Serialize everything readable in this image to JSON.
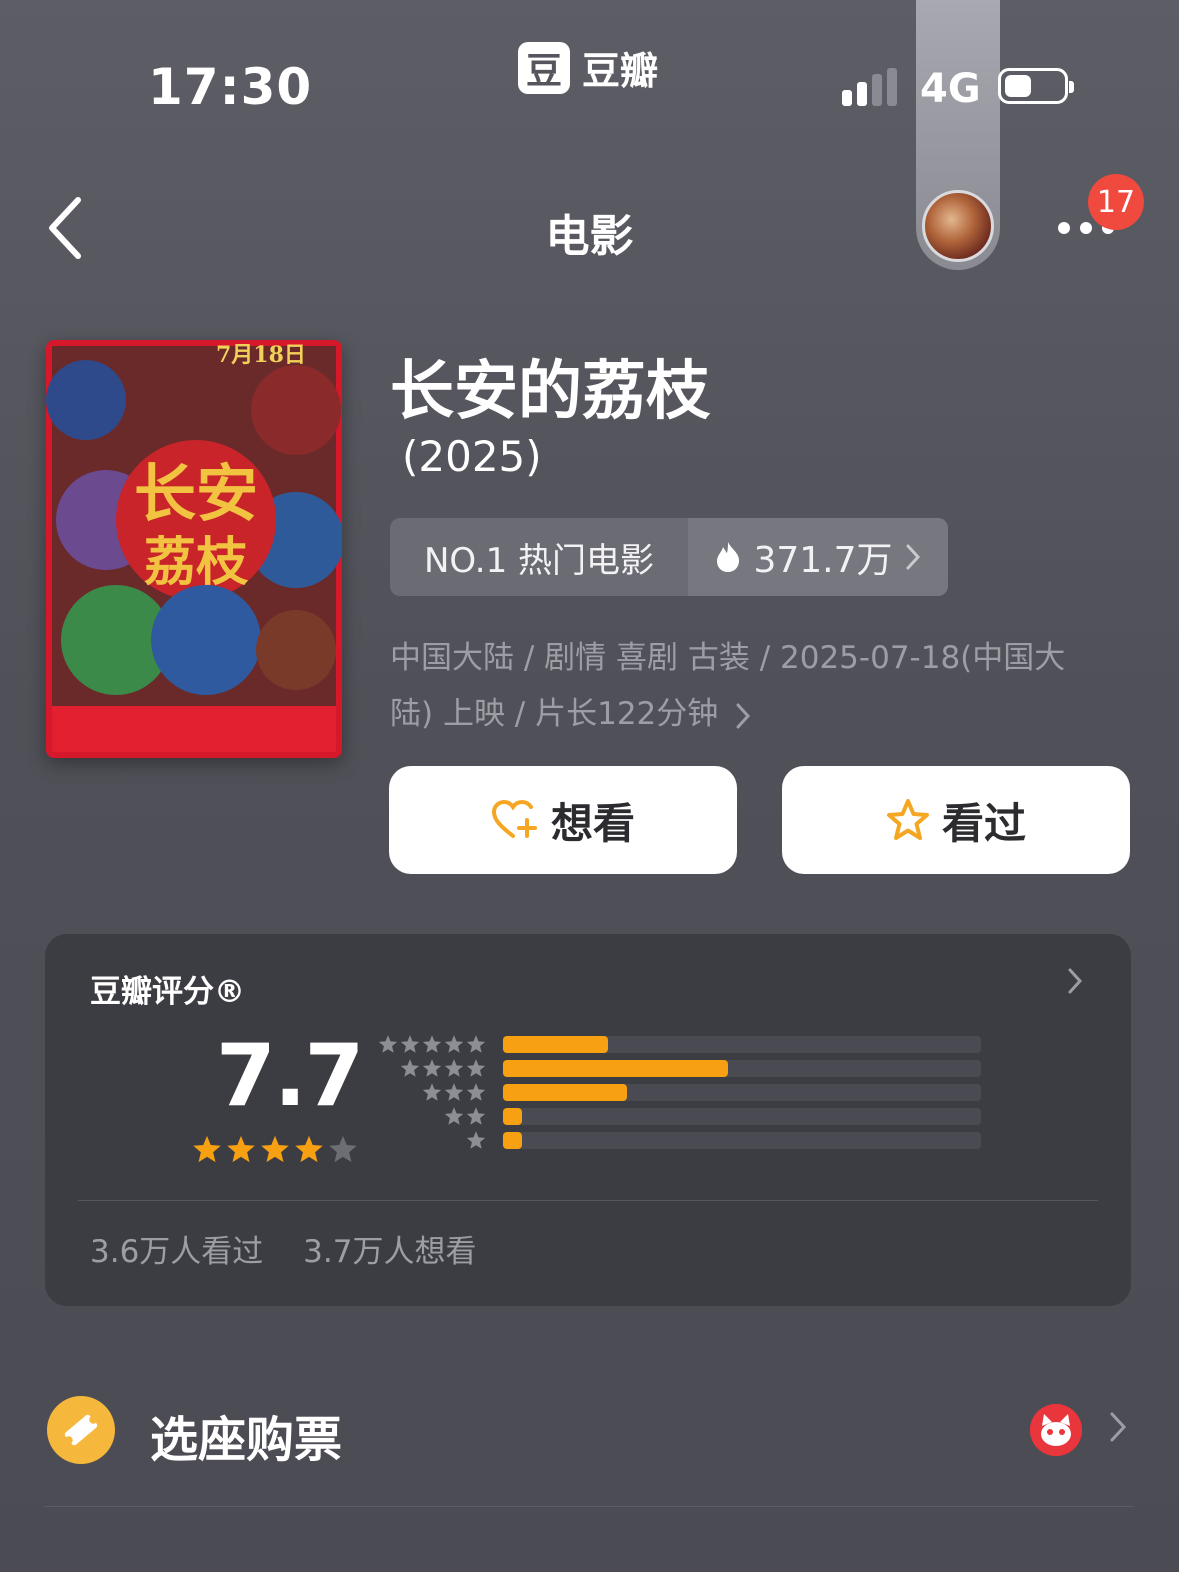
{
  "status_bar": {
    "time": "17:30",
    "brand_logo_char": "豆",
    "brand_name": "豆瓣",
    "network": "4G",
    "battery_level": 0.3
  },
  "nav": {
    "title": "电影",
    "notification_count": "17"
  },
  "movie": {
    "title": "长安的荔枝",
    "year": "(2025)",
    "rank_label": "NO.1 热门电影",
    "heat_value": "371.7万",
    "meta_line1": "中国大陆 / 剧情 喜剧 古装 / 2025-07-18(中国大",
    "meta_line2": "陆) 上映 / 片长122分钟"
  },
  "actions": {
    "want_label": "想看",
    "seen_label": "看过"
  },
  "rating": {
    "title": "豆瓣评分®",
    "score": "7.7",
    "score_stars": 4,
    "distribution": [
      {
        "stars": 5,
        "fraction": 0.22
      },
      {
        "stars": 4,
        "fraction": 0.47
      },
      {
        "stars": 3,
        "fraction": 0.26
      },
      {
        "stars": 2,
        "fraction": 0.04
      },
      {
        "stars": 1,
        "fraction": 0.04
      }
    ],
    "seen_count": "3.6万人看过",
    "want_count": "3.7万人想看"
  },
  "ticket": {
    "label": "选座购票"
  },
  "colors": {
    "accent": "#f6a012",
    "badge": "#f0493e",
    "ticket_icon": "#f5b73c"
  }
}
